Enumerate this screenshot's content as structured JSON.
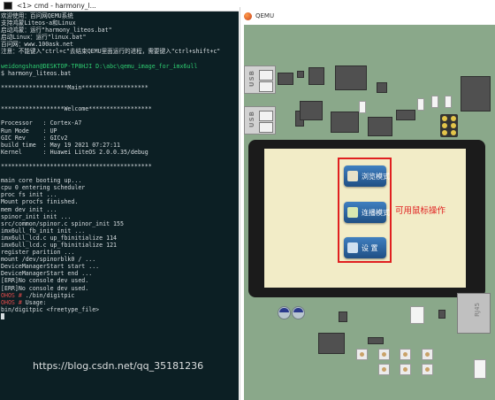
{
  "cmd_window": {
    "title": "<1> cmd - harmony_l...",
    "lines": [
      {
        "text": "欢迎使用：百问网QEMU系统",
        "style": "c-dim"
      },
      {
        "text": "支持鸿蒙Liteos-a和Linux",
        "style": "c-dim"
      },
      {
        "text": "启动鸿蒙：运行\"harmony_liteos.bat\"",
        "style": "c-dim"
      },
      {
        "text": "启动Linux：运行\"linux.bat\"",
        "style": "c-dim"
      },
      {
        "text": "百问网：www.100ask.net",
        "style": "c-dim"
      },
      {
        "text": "注意：不能键入\"ctrl+c\"去结束QEMU里面运行的进程，需要键入\"ctrl+shift+c\"",
        "style": "c-dim"
      },
      {
        "text": "",
        "style": "c-dim"
      },
      {
        "text": "weidongshan@DESKTOP-TP8HJI D:\\abc\\qemu_image_for_imx6ull",
        "style": "c-green"
      },
      {
        "text": "$ harmony_liteos.bat",
        "style": "c-dim"
      },
      {
        "text": "",
        "style": "c-dim"
      },
      {
        "text": "*******************Main*******************",
        "style": "c-dim"
      },
      {
        "text": "",
        "style": "c-dim"
      },
      {
        "text": "",
        "style": "c-dim"
      },
      {
        "text": "******************Welcome******************",
        "style": "c-dim"
      },
      {
        "text": "",
        "style": "c-dim"
      },
      {
        "text": "Processor   : Cortex-A7",
        "style": "c-dim"
      },
      {
        "text": "Run Mode    : UP",
        "style": "c-dim"
      },
      {
        "text": "GIC Rev     : GICv2",
        "style": "c-dim"
      },
      {
        "text": "build time  : May 19 2021 07:27:11",
        "style": "c-dim"
      },
      {
        "text": "Kernel      : Huawei LiteOS 2.0.0.35/debug",
        "style": "c-dim"
      },
      {
        "text": "",
        "style": "c-dim"
      },
      {
        "text": "*******************************************",
        "style": "c-dim"
      },
      {
        "text": "",
        "style": "c-dim"
      },
      {
        "text": "main core booting up...",
        "style": "c-dim"
      },
      {
        "text": "cpu 0 entering scheduler",
        "style": "c-dim"
      },
      {
        "text": "proc fs init ...",
        "style": "c-dim"
      },
      {
        "text": "Mount procfs finished.",
        "style": "c-dim"
      },
      {
        "text": "mem dev init ...",
        "style": "c-dim"
      },
      {
        "text": "spinor_init init ...",
        "style": "c-dim"
      },
      {
        "text": "src/common/spinor.c spinor_init 155",
        "style": "c-dim"
      },
      {
        "text": "imx6ull_fb_init init ...",
        "style": "c-dim"
      },
      {
        "text": "imx6ull_lcd.c up_fbinitialize 114",
        "style": "c-dim"
      },
      {
        "text": "imx6ull_lcd.c up_fbinitialize 121",
        "style": "c-dim"
      },
      {
        "text": "register parition ...",
        "style": "c-dim"
      },
      {
        "text": "mount /dev/spinorblk0 / ...",
        "style": "c-dim"
      },
      {
        "text": "DeviceManagerStart start ...",
        "style": "c-dim"
      },
      {
        "text": "DeviceManagerStart end ...",
        "style": "c-dim"
      },
      {
        "text": "[ERR]No console dev used.",
        "style": "c-dim"
      },
      {
        "text": "[ERR]No console dev used.",
        "style": "c-dim"
      },
      {
        "text": "OHOS # ./bin/digitpic",
        "style": "c-dim",
        "prompt": "OHOS # "
      },
      {
        "text": "OHOS # Usage:",
        "style": "c-dim",
        "prompt": "OHOS # "
      },
      {
        "text": "bin/digitpic <freetype_file>",
        "style": "c-dim"
      }
    ]
  },
  "qemu_window": {
    "title": "QEMU",
    "board": {
      "usb_label_top": "USB",
      "usb_label_bottom": "USB",
      "rj45_label": "RJ45",
      "menu_buttons": [
        {
          "label": "浏览模式",
          "icon": "browse-icon",
          "color": "#e8e2c8"
        },
        {
          "label": "连播模式",
          "icon": "slideshow-icon",
          "color": "#d9e8b0"
        },
        {
          "label": "设 置",
          "icon": "settings-icon",
          "color": "#cfe0f0"
        }
      ],
      "hint_text": "可用鼠标操作"
    }
  },
  "watermark": "https://blog.csdn.net/qq_35181236",
  "colors": {
    "accent_red": "#e02020",
    "prompt_red": "#e14b4b",
    "path_green": "#2ecc71"
  }
}
